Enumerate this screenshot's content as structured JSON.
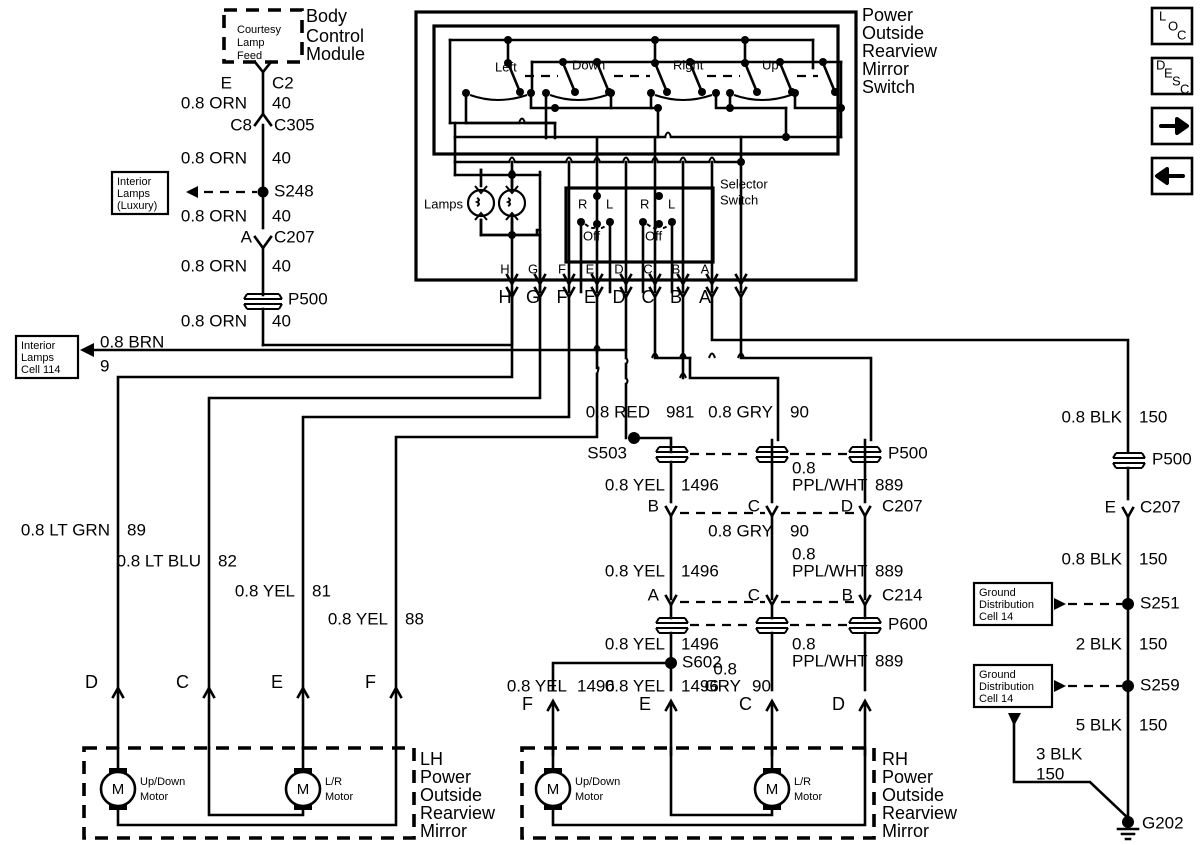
{
  "diagram": {
    "title": "Power Outside Rearview Mirror Switch",
    "bcm": {
      "module_label": "Body\nControl\nModule",
      "module_line1": "Body",
      "module_line2": "Control",
      "module_line3": "Module",
      "inner_label1": "Courtesy",
      "inner_label2": "Lamp",
      "inner_label3": "Feed"
    },
    "switch_block": {
      "title_lines": [
        "Power",
        "Outside",
        "Rearview",
        "Mirror",
        "Switch"
      ],
      "contacts": [
        "Left",
        "Down",
        "Right",
        "Up"
      ],
      "lamps_label": "Lamps",
      "selector_label_1": "Selector",
      "selector_label_2": "Switch",
      "selector_positions": [
        "R",
        "L",
        "Off",
        "R",
        "L",
        "Off"
      ],
      "pins_inner": [
        "H",
        "G",
        "F",
        "E",
        "D",
        "C",
        "B",
        "A"
      ],
      "pins_outer": [
        "H",
        "G",
        "F",
        "E",
        "D",
        "C",
        "B",
        "A"
      ]
    },
    "cells": {
      "interior_lamps_luxury": [
        "Interior",
        "Lamps",
        "(Luxury)"
      ],
      "interior_lamps_114": [
        "Interior",
        "Lamps",
        "Cell 114"
      ],
      "ground_dist_1": [
        "Ground",
        "Distribution",
        "Cell 14"
      ],
      "ground_dist_2": [
        "Ground",
        "Distribution",
        "Cell 14"
      ]
    },
    "orn_branch": {
      "pin_E": "E",
      "conn_C2": "C2",
      "w1_color": "0.8 ORN",
      "w1_num": "40",
      "pin_C8": "C8",
      "conn_C305": "C305",
      "w2_color": "0.8 ORN",
      "w2_num": "40",
      "splice_S248": "S248",
      "w3_color": "0.8 ORN",
      "w3_num": "40",
      "pin_A": "A",
      "conn_C207": "C207",
      "w4_color": "0.8 ORN",
      "w4_num": "40",
      "plug_P500": "P500",
      "w5_color": "0.8 ORN",
      "w5_num": "40"
    },
    "left_wires": {
      "brn_color": "0.8 BRN",
      "brn_num": "9",
      "ltgrn_color": "0.8 LT GRN",
      "ltgrn_num": "89",
      "ltblu_color": "0.8 LT BLU",
      "ltblu_num": "82",
      "yel81_color": "0.8 YEL",
      "yel81_num": "81",
      "yel88_color": "0.8 YEL",
      "yel88_num": "88",
      "pins": [
        "D",
        "C",
        "E",
        "F"
      ]
    },
    "center_wires": {
      "red_color": "0.8 RED",
      "red_num": "981",
      "splice_S503": "S503",
      "gry_top_color": "0.8 GRY",
      "gry_top_num": "90",
      "plug_P500": "P500",
      "yel_1_color": "0.8 YEL",
      "yel_1_num": "1496",
      "pplwht_1_color": "0.8\nPPL/WHT",
      "pplwht_1_l1": "0.8",
      "pplwht_1_l2": "PPL/WHT",
      "pplwht_1_num": "889",
      "c207_pins": [
        "B",
        "C",
        "D"
      ],
      "c207_label": "C207",
      "gry_mid_color": "0.8 GRY",
      "gry_mid_num": "90",
      "yel_2_color": "0.8 YEL",
      "yel_2_num": "1496",
      "pplwht_2_l1": "0.8",
      "pplwht_2_l2": "PPL/WHT",
      "pplwht_2_num": "889",
      "c214_pins": [
        "A",
        "C",
        "B"
      ],
      "c214_label": "C214",
      "plug_P600": "P600",
      "yel_3_color": "0.8 YEL",
      "yel_3_num": "1496",
      "splice_S602": "S602",
      "pplwht_3_l1": "0.8",
      "pplwht_3_l2": "PPL/WHT",
      "pplwht_3_num": "889",
      "yel_F_color": "0.8 YEL",
      "yel_F_num": "1496",
      "yel_E_color": "0.8 YEL",
      "yel_E_num": "1496",
      "gry_bot_l1": "0.8",
      "gry_bot_l2": "GRY",
      "gry_bot_num": "90",
      "rh_pins": [
        "F",
        "E",
        "C",
        "D"
      ]
    },
    "ground_branch": {
      "blk1_color": "0.8 BLK",
      "blk1_num": "150",
      "plug_P500": "P500",
      "pin_E": "E",
      "conn_C207": "C207",
      "blk2_color": "0.8 BLK",
      "blk2_num": "150",
      "splice_S251": "S251",
      "blk3_color": "2 BLK",
      "blk3_num": "150",
      "splice_S259": "S259",
      "blk4_color": "5 BLK",
      "blk4_num": "150",
      "blk5_color": "3 BLK",
      "blk5_num": "150",
      "ground_G202": "G202"
    },
    "lh_mirror": {
      "title_lines": [
        "LH",
        "Power",
        "Outside",
        "Rearview",
        "Mirror"
      ],
      "motor1_l1": "Up/Down",
      "motor1_l2": "Motor",
      "motor1_sym": "M",
      "motor2_l1": "L/R",
      "motor2_l2": "Motor",
      "motor2_sym": "M"
    },
    "rh_mirror": {
      "title_lines": [
        "RH",
        "Power",
        "Outside",
        "Rearview",
        "Mirror"
      ],
      "motor1_l1": "Up/Down",
      "motor1_l2": "Motor",
      "motor1_sym": "M",
      "motor2_l1": "L/R",
      "motor2_l2": "Motor",
      "motor2_sym": "M"
    },
    "nav_buttons": {
      "loc": [
        "L",
        "O",
        "C"
      ],
      "desc": [
        "D",
        "E",
        "S",
        "C"
      ],
      "next": "next-arrow",
      "prev": "prev-arrow"
    }
  }
}
